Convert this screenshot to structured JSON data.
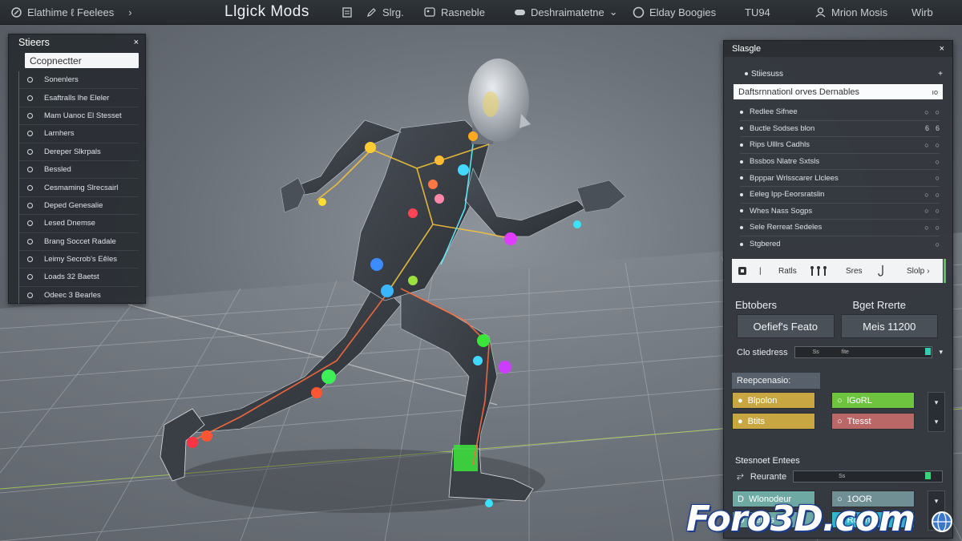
{
  "topbar": {
    "left_item": "Elathime ℓ Feelees",
    "title": "Llgick Mods",
    "menu_1": "Slrg.",
    "menu_2": "Rasneble",
    "menu_3": "Deshraimatetne",
    "menu_4": "Elday Boogies",
    "menu_5": "TU94",
    "menu_6": "Mrion Mosis",
    "menu_7": "Wirb"
  },
  "left_panel": {
    "title": "Stieers",
    "search_value": "Ccopnectter",
    "items": [
      "Sonenlers",
      "Esaftralls lhe Eleler",
      "Mam Uanoc El Stesset",
      "Larnhers",
      "Dereper Slkrpals",
      "Bessled",
      "Cesmaming Slrecsairl",
      "Deped Genesalie",
      "Lesed Dnemse",
      "Brang Soccet Radale",
      "Leimy Secrob's Eêles",
      "Loads 32 Baetst",
      "Odeec 3 Bearles"
    ]
  },
  "right_panel": {
    "title": "Slasgle",
    "subsection": "Stiiesuss",
    "search_value": "Daftsrnnationl orves Dernables",
    "items": [
      {
        "label": "Redlee Sifnee",
        "flags": [
          "○",
          "○"
        ]
      },
      {
        "label": "Buctle Sodses blon",
        "flags": [
          "6",
          "6"
        ]
      },
      {
        "label": "Rips Ulllrs Cadhls",
        "flags": [
          "○",
          "○"
        ]
      },
      {
        "label": "Bssbos Nlatre Sxtsls",
        "flags": [
          "○"
        ]
      },
      {
        "label": "Bpppar Wrlsscarer Llclees",
        "flags": [
          "○"
        ]
      },
      {
        "label": "Eeleg Ipp-Eeorsratslin",
        "flags": [
          "○",
          "○"
        ]
      },
      {
        "label": "Whes Nass Sogps",
        "flags": [
          "○",
          "○"
        ]
      },
      {
        "label": "Sele Rerreat Sedeles",
        "flags": [
          "○",
          "○"
        ]
      },
      {
        "label": "Stgbered",
        "flags": [
          "○"
        ]
      }
    ],
    "tools": {
      "t1": "Ratls",
      "t2": "Sres",
      "t3": "Slolp"
    },
    "field_left_label": "Ebtobers",
    "field_right_label": "Bget Rrerte",
    "field_left_value": "Oefief's Feato",
    "field_right_value": "Meis 11200",
    "slider1_label": "Clo stiedress",
    "slider1_tick1": "Ss",
    "slider1_tick2": "fite",
    "section_header": "Reepcenasio:",
    "buttons": {
      "b1": "Blpolon",
      "b2": "Btits",
      "b3": "lGoRL",
      "b4": "Ttesst"
    },
    "section2": "Stesnoet Entees",
    "slider2_label": "Reurante",
    "slider2_tick": "Ss",
    "buttons2": {
      "b1": "Wlonodeur",
      "b2": "Beites",
      "b3": "1OOR",
      "b4": "Rolbn"
    },
    "colors": {
      "yellow": "#c8a742",
      "green": "#6ec43f",
      "red": "#b96767",
      "teal": "#6fa9a3",
      "slate": "#6f8f95",
      "cyan": "#36b7cc"
    }
  },
  "watermark": "Foro3D.com"
}
